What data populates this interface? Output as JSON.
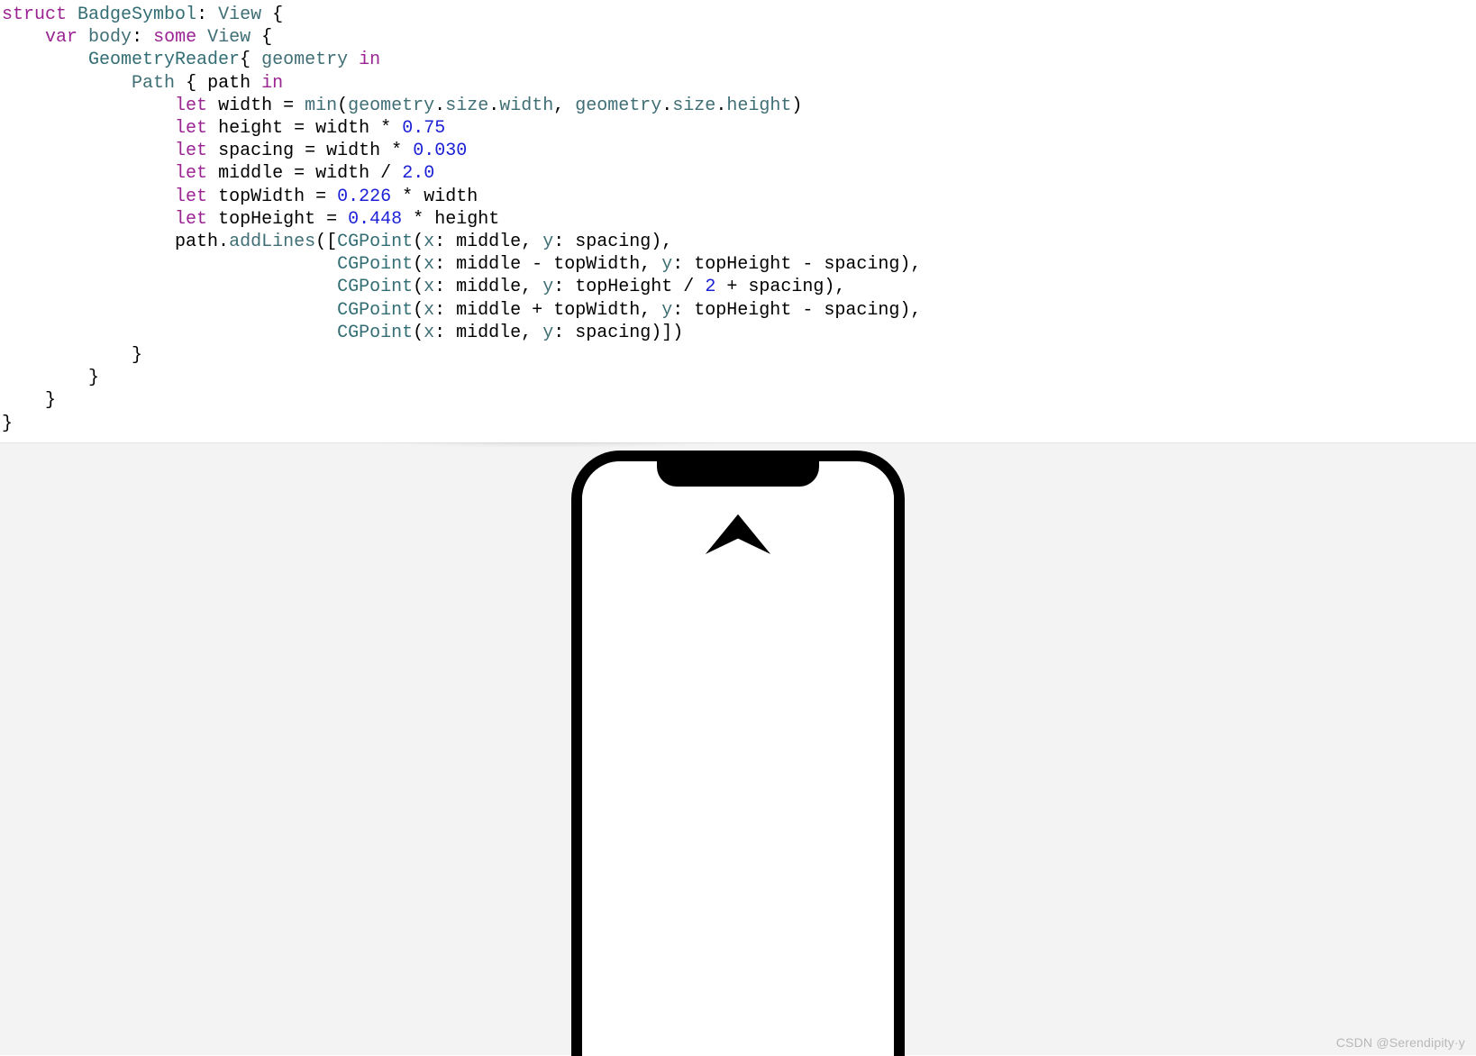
{
  "code": {
    "l1": {
      "struct": "struct",
      "name": "BadgeSymbol",
      "colon": ":",
      "view": "View",
      "brace": "{"
    },
    "l2": {
      "var": "var",
      "body": "body",
      "colon": ":",
      "some": "some",
      "view": "View",
      "brace": "{"
    },
    "l3": {
      "reader": "GeometryReader",
      "brace": "{",
      "geometry": "geometry",
      "in": "in"
    },
    "l4": {
      "path": "Path",
      "brace": "{",
      "pathvar": "path",
      "in": "in"
    },
    "l5": {
      "let": "let",
      "w": "width",
      "eq": "=",
      "min": "min",
      "lp": "(",
      "geo": "geometry",
      "dot": ".",
      "size": "size",
      "dot2": ".",
      "width": "width",
      "comma": ",",
      "geo2": "geometry",
      "dot3": ".",
      "size2": "size",
      "dot4": ".",
      "height": "height",
      "rp": ")"
    },
    "l6": {
      "let": "let",
      "h": "height",
      "eq": "=",
      "w": "width",
      "mul": "*",
      "n": "0.75"
    },
    "l7": {
      "let": "let",
      "s": "spacing",
      "eq": "=",
      "w": "width",
      "mul": "*",
      "n": "0.030"
    },
    "l8": {
      "let": "let",
      "m": "middle",
      "eq": "=",
      "w": "width",
      "div": "/",
      "n": "2.0"
    },
    "l9": {
      "let": "let",
      "tw": "topWidth",
      "eq": "=",
      "n": "0.226",
      "mul": "*",
      "w": "width"
    },
    "l10": {
      "let": "let",
      "th": "topHeight",
      "eq": "=",
      "n": "0.448",
      "mul": "*",
      "h": "height"
    },
    "l11": {
      "path": "path",
      "dot": ".",
      "fn": "addLines",
      "lp": "([",
      "cg": "CGPoint",
      "lp2": "(",
      "x": "x",
      "c": ":",
      "mid": "middle",
      "cm": ",",
      "y": "y",
      "c2": ":",
      "sp": "spacing",
      "rp": "),"
    },
    "l12": {
      "cg": "CGPoint",
      "lp": "(",
      "x": "x",
      "c": ":",
      "mid": "middle",
      "minus": "-",
      "tw": "topWidth",
      "cm": ",",
      "y": "y",
      "c2": ":",
      "th": "topHeight",
      "minus2": "-",
      "sp": "spacing",
      "rp": "),"
    },
    "l13": {
      "cg": "CGPoint",
      "lp": "(",
      "x": "x",
      "c": ":",
      "mid": "middle",
      "cm": ",",
      "y": "y",
      "c2": ":",
      "th": "topHeight",
      "div": "/",
      "n": "2",
      "plus": "+",
      "sp": "spacing",
      "rp": "),"
    },
    "l14": {
      "cg": "CGPoint",
      "lp": "(",
      "x": "x",
      "c": ":",
      "mid": "middle",
      "plus": "+",
      "tw": "topWidth",
      "cm": ",",
      "y": "y",
      "c2": ":",
      "th": "topHeight",
      "minus": "-",
      "sp": "spacing",
      "rp": "),"
    },
    "l15": {
      "cg": "CGPoint",
      "lp": "(",
      "x": "x",
      "c": ":",
      "mid": "middle",
      "cm": ",",
      "y": "y",
      "c2": ":",
      "sp": "spacing",
      "rp": ")])"
    },
    "l16": {
      "brace": "}"
    },
    "l17": {
      "brace": "}"
    },
    "l18": {
      "brace": "}"
    },
    "l19": {
      "brace": "}"
    }
  },
  "watermark": "CSDN @Serendipity·y"
}
